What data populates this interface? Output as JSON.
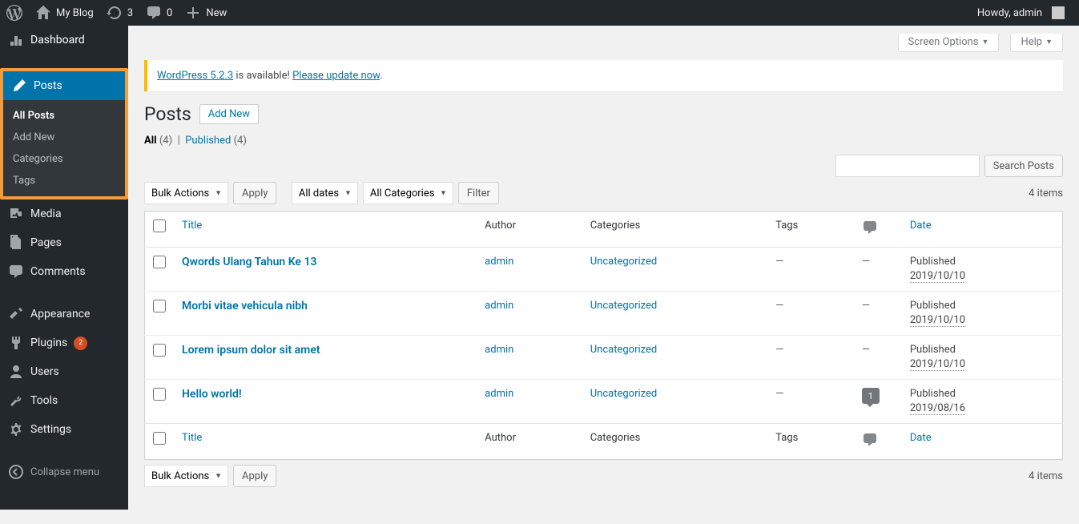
{
  "adminbar": {
    "site_name": "My Blog",
    "updates": "3",
    "comments": "0",
    "new_label": "New",
    "howdy": "Howdy, admin"
  },
  "menu": {
    "dashboard": "Dashboard",
    "posts": "Posts",
    "posts_sub": {
      "all_posts": "All Posts",
      "add_new": "Add New",
      "categories": "Categories",
      "tags": "Tags"
    },
    "media": "Media",
    "pages": "Pages",
    "comments": "Comments",
    "appearance": "Appearance",
    "plugins": "Plugins",
    "plugins_count": "2",
    "users": "Users",
    "tools": "Tools",
    "settings": "Settings",
    "collapse": "Collapse menu"
  },
  "screen_meta": {
    "screen_options": "Screen Options",
    "help": "Help"
  },
  "notice": {
    "part1": "WordPress 5.2.3",
    "part2": " is available! ",
    "part3": "Please update now",
    "part4": "."
  },
  "header": {
    "title": "Posts",
    "add_new": "Add New"
  },
  "subsubsub": {
    "all_label": "All",
    "all_count": "(4)",
    "published_label": "Published",
    "published_count": "(4)"
  },
  "filters": {
    "bulk_actions": "Bulk Actions",
    "apply": "Apply",
    "all_dates": "All dates",
    "all_categories": "All Categories",
    "filter": "Filter",
    "search_posts": "Search Posts",
    "items": "4 items"
  },
  "columns": {
    "title": "Title",
    "author": "Author",
    "categories": "Categories",
    "tags": "Tags",
    "date": "Date"
  },
  "rows": [
    {
      "title": "Qwords Ulang Tahun Ke 13",
      "author": "admin",
      "categories": "Uncategorized",
      "tags": "—",
      "comments": "—",
      "status": "Published",
      "date": "2019/10/10"
    },
    {
      "title": "Morbi vitae vehicula nibh",
      "author": "admin",
      "categories": "Uncategorized",
      "tags": "—",
      "comments": "—",
      "status": "Published",
      "date": "2019/10/10"
    },
    {
      "title": "Lorem ipsum dolor sit amet",
      "author": "admin",
      "categories": "Uncategorized",
      "tags": "—",
      "comments": "—",
      "status": "Published",
      "date": "2019/10/10"
    },
    {
      "title": "Hello world!",
      "author": "admin",
      "categories": "Uncategorized",
      "tags": "—",
      "comments": "1",
      "status": "Published",
      "date": "2019/08/16"
    }
  ]
}
